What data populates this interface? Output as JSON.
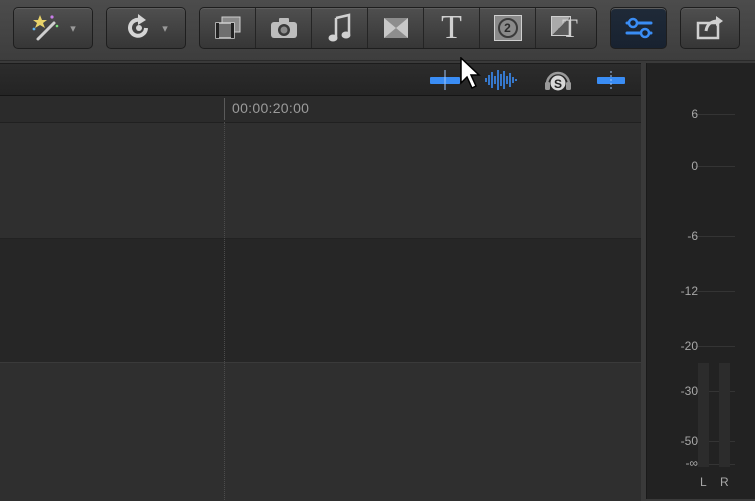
{
  "toolbar": {
    "enhance_button": {
      "icon": "magic-wand-icon",
      "caret": "▾"
    },
    "retime_button": {
      "icon": "retime-icon",
      "caret": "▾"
    },
    "media_browsers": [
      {
        "id": "photos-video",
        "icon": "film-photo-icon"
      },
      {
        "id": "photos",
        "icon": "camera-icon"
      },
      {
        "id": "music",
        "icon": "music-note-icon"
      },
      {
        "id": "transitions",
        "icon": "transition-icon"
      },
      {
        "id": "titles",
        "icon": "title-T-icon",
        "glyph": "T"
      },
      {
        "id": "generators",
        "icon": "generator-icon",
        "glyph": "2"
      },
      {
        "id": "themes",
        "icon": "theme-icon",
        "glyph": "T"
      }
    ],
    "inspector_button": {
      "icon": "inspector-sliders-icon"
    },
    "share_button": {
      "icon": "share-icon"
    }
  },
  "timeline": {
    "timecode": "00:00:20:00",
    "header_controls": [
      {
        "id": "clip-appearance",
        "icon": "clip-appearance-icon"
      },
      {
        "id": "audio-waveform",
        "icon": "waveform-icon"
      },
      {
        "id": "solo",
        "icon": "solo-headphones-icon",
        "glyph": "S"
      },
      {
        "id": "snapping",
        "icon": "snapping-icon"
      }
    ]
  },
  "audio_meter": {
    "scale": [
      "6",
      "0",
      "-6",
      "-12",
      "-20",
      "-30",
      "-50",
      "-∞"
    ],
    "channels": [
      "L",
      "R"
    ]
  },
  "colors": {
    "accent": "#3a8df5",
    "background": "#2e2e2e"
  }
}
